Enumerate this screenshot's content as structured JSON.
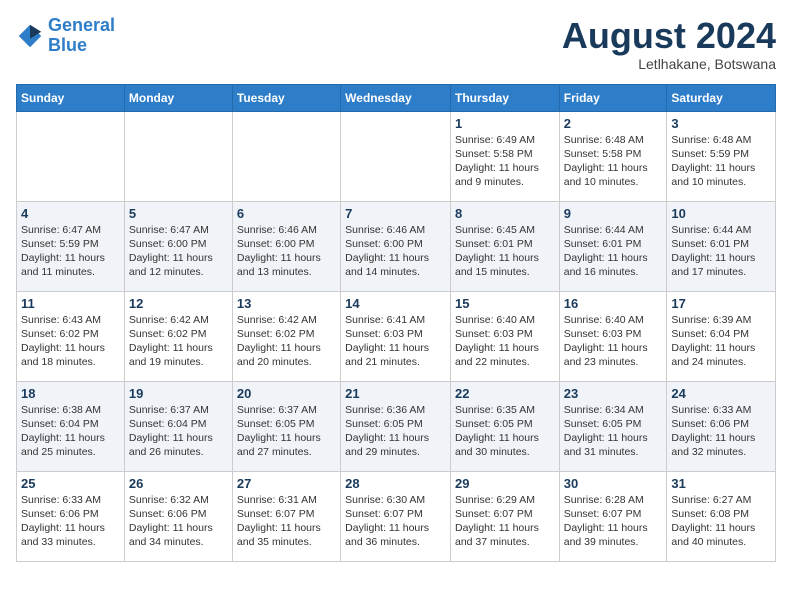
{
  "header": {
    "logo_line1": "General",
    "logo_line2": "Blue",
    "month_title": "August 2024",
    "subtitle": "Letlhakane, Botswana"
  },
  "weekdays": [
    "Sunday",
    "Monday",
    "Tuesday",
    "Wednesday",
    "Thursday",
    "Friday",
    "Saturday"
  ],
  "weeks": [
    [
      {
        "day": "",
        "info": ""
      },
      {
        "day": "",
        "info": ""
      },
      {
        "day": "",
        "info": ""
      },
      {
        "day": "",
        "info": ""
      },
      {
        "day": "1",
        "info": "Sunrise: 6:49 AM\nSunset: 5:58 PM\nDaylight: 11 hours and 9 minutes."
      },
      {
        "day": "2",
        "info": "Sunrise: 6:48 AM\nSunset: 5:58 PM\nDaylight: 11 hours and 10 minutes."
      },
      {
        "day": "3",
        "info": "Sunrise: 6:48 AM\nSunset: 5:59 PM\nDaylight: 11 hours and 10 minutes."
      }
    ],
    [
      {
        "day": "4",
        "info": "Sunrise: 6:47 AM\nSunset: 5:59 PM\nDaylight: 11 hours and 11 minutes."
      },
      {
        "day": "5",
        "info": "Sunrise: 6:47 AM\nSunset: 6:00 PM\nDaylight: 11 hours and 12 minutes."
      },
      {
        "day": "6",
        "info": "Sunrise: 6:46 AM\nSunset: 6:00 PM\nDaylight: 11 hours and 13 minutes."
      },
      {
        "day": "7",
        "info": "Sunrise: 6:46 AM\nSunset: 6:00 PM\nDaylight: 11 hours and 14 minutes."
      },
      {
        "day": "8",
        "info": "Sunrise: 6:45 AM\nSunset: 6:01 PM\nDaylight: 11 hours and 15 minutes."
      },
      {
        "day": "9",
        "info": "Sunrise: 6:44 AM\nSunset: 6:01 PM\nDaylight: 11 hours and 16 minutes."
      },
      {
        "day": "10",
        "info": "Sunrise: 6:44 AM\nSunset: 6:01 PM\nDaylight: 11 hours and 17 minutes."
      }
    ],
    [
      {
        "day": "11",
        "info": "Sunrise: 6:43 AM\nSunset: 6:02 PM\nDaylight: 11 hours and 18 minutes."
      },
      {
        "day": "12",
        "info": "Sunrise: 6:42 AM\nSunset: 6:02 PM\nDaylight: 11 hours and 19 minutes."
      },
      {
        "day": "13",
        "info": "Sunrise: 6:42 AM\nSunset: 6:02 PM\nDaylight: 11 hours and 20 minutes."
      },
      {
        "day": "14",
        "info": "Sunrise: 6:41 AM\nSunset: 6:03 PM\nDaylight: 11 hours and 21 minutes."
      },
      {
        "day": "15",
        "info": "Sunrise: 6:40 AM\nSunset: 6:03 PM\nDaylight: 11 hours and 22 minutes."
      },
      {
        "day": "16",
        "info": "Sunrise: 6:40 AM\nSunset: 6:03 PM\nDaylight: 11 hours and 23 minutes."
      },
      {
        "day": "17",
        "info": "Sunrise: 6:39 AM\nSunset: 6:04 PM\nDaylight: 11 hours and 24 minutes."
      }
    ],
    [
      {
        "day": "18",
        "info": "Sunrise: 6:38 AM\nSunset: 6:04 PM\nDaylight: 11 hours and 25 minutes."
      },
      {
        "day": "19",
        "info": "Sunrise: 6:37 AM\nSunset: 6:04 PM\nDaylight: 11 hours and 26 minutes."
      },
      {
        "day": "20",
        "info": "Sunrise: 6:37 AM\nSunset: 6:05 PM\nDaylight: 11 hours and 27 minutes."
      },
      {
        "day": "21",
        "info": "Sunrise: 6:36 AM\nSunset: 6:05 PM\nDaylight: 11 hours and 29 minutes."
      },
      {
        "day": "22",
        "info": "Sunrise: 6:35 AM\nSunset: 6:05 PM\nDaylight: 11 hours and 30 minutes."
      },
      {
        "day": "23",
        "info": "Sunrise: 6:34 AM\nSunset: 6:05 PM\nDaylight: 11 hours and 31 minutes."
      },
      {
        "day": "24",
        "info": "Sunrise: 6:33 AM\nSunset: 6:06 PM\nDaylight: 11 hours and 32 minutes."
      }
    ],
    [
      {
        "day": "25",
        "info": "Sunrise: 6:33 AM\nSunset: 6:06 PM\nDaylight: 11 hours and 33 minutes."
      },
      {
        "day": "26",
        "info": "Sunrise: 6:32 AM\nSunset: 6:06 PM\nDaylight: 11 hours and 34 minutes."
      },
      {
        "day": "27",
        "info": "Sunrise: 6:31 AM\nSunset: 6:07 PM\nDaylight: 11 hours and 35 minutes."
      },
      {
        "day": "28",
        "info": "Sunrise: 6:30 AM\nSunset: 6:07 PM\nDaylight: 11 hours and 36 minutes."
      },
      {
        "day": "29",
        "info": "Sunrise: 6:29 AM\nSunset: 6:07 PM\nDaylight: 11 hours and 37 minutes."
      },
      {
        "day": "30",
        "info": "Sunrise: 6:28 AM\nSunset: 6:07 PM\nDaylight: 11 hours and 39 minutes."
      },
      {
        "day": "31",
        "info": "Sunrise: 6:27 AM\nSunset: 6:08 PM\nDaylight: 11 hours and 40 minutes."
      }
    ]
  ]
}
